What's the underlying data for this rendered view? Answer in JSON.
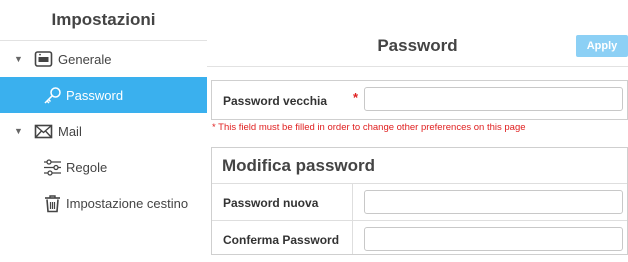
{
  "sidebar": {
    "title": "Impostazioni",
    "items": [
      {
        "label": "Generale",
        "icon": "monitor-icon",
        "expandable": true,
        "active": false
      },
      {
        "label": "Password",
        "icon": "key-icon",
        "expandable": false,
        "active": true
      },
      {
        "label": "Mail",
        "icon": "envelope-icon",
        "expandable": true,
        "active": false
      },
      {
        "label": "Regole",
        "icon": "sliders-icon",
        "expandable": false,
        "active": false
      },
      {
        "label": "Impostazione cestino",
        "icon": "trash-icon",
        "expandable": false,
        "active": false
      }
    ]
  },
  "header": {
    "title": "Password",
    "apply_label": "Apply"
  },
  "old_password": {
    "label": "Password vecchia",
    "required_mark": "*",
    "value": "",
    "error": "* This field must be filled in order to change other preferences on this page"
  },
  "change_password": {
    "title": "Modifica password",
    "new_label": "Password nuova",
    "new_value": "",
    "confirm_label": "Conferma Password",
    "confirm_value": ""
  },
  "colors": {
    "accent": "#3ab0ee",
    "apply_button": "#8cd0f5",
    "error": "#e02020"
  }
}
